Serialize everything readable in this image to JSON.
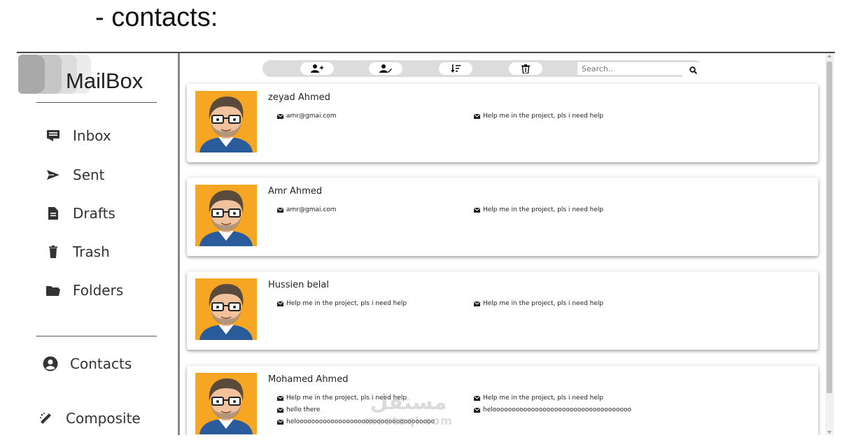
{
  "slide_title": "- contacts:",
  "app_name": "MailBox",
  "sidebar": {
    "items": [
      {
        "label": "Inbox",
        "icon": "inbox-icon"
      },
      {
        "label": "Sent",
        "icon": "send-icon"
      },
      {
        "label": "Drafts",
        "icon": "drafts-icon"
      },
      {
        "label": "Trash",
        "icon": "trash-icon"
      },
      {
        "label": "Folders",
        "icon": "folder-icon"
      },
      {
        "label": "Contacts",
        "icon": "user-circle-icon"
      },
      {
        "label": "Composite",
        "icon": "compose-icon"
      }
    ]
  },
  "toolbar": {
    "buttons": [
      "add-contact-icon",
      "edit-contact-icon",
      "sort-icon",
      "delete-icon"
    ],
    "search_placeholder": "Search..",
    "search_icon": "search-icon"
  },
  "contacts": [
    {
      "name": "zeyad Ahmed",
      "lines": [
        {
          "col": 0,
          "text": "amr@gmai.com"
        },
        {
          "col": 1,
          "text": "Help me in the project, pls i need help"
        }
      ]
    },
    {
      "name": "Amr Ahmed",
      "lines": [
        {
          "col": 0,
          "text": "amr@gmai.com"
        },
        {
          "col": 1,
          "text": "Help me in the project, pls i need help"
        }
      ]
    },
    {
      "name": "Hussien belal",
      "lines": [
        {
          "col": 0,
          "text": "Help me in the project, pls i need help"
        },
        {
          "col": 1,
          "text": "Help me in the project, pls i need help"
        }
      ]
    },
    {
      "name": "Mohamed Ahmed",
      "lines": [
        {
          "col": 0,
          "text": "Help me in the project, pls i need help"
        },
        {
          "col": 1,
          "text": "Help me in the project, pls i need help"
        },
        {
          "col": 0,
          "text": "hello there"
        },
        {
          "col": 1,
          "text": "heloooooooooooooooooooooooooooooooooooo"
        },
        {
          "col": 0,
          "text": "heloooooooooooooooooooooooooooooooooooo"
        }
      ]
    }
  ],
  "watermark": {
    "arabic": "مستقل",
    "latin": "mostaql.com"
  },
  "colors": {
    "avatar_bg": "#f6a623",
    "shirt": "#2a5b9a",
    "toolbar": "#dcdcdc"
  }
}
